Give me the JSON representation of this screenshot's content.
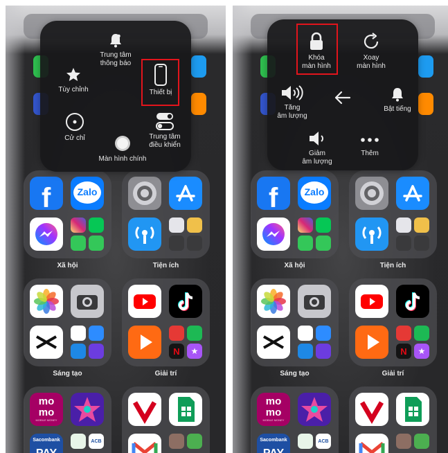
{
  "folders": {
    "social": "Xã hội",
    "utilities": "Tiện ích",
    "creative": "Sáng tạo",
    "entertainment": "Giải trí"
  },
  "apps": {
    "zalo": "Zalo",
    "momo_top": "mo",
    "momo_bottom": "mo",
    "momo_tag": "MOBILE MONEY",
    "sacombank": "Sacombank",
    "pay": "PAY",
    "acb": "ACB"
  },
  "left_menu": {
    "notification_center": "Trung tâm\nthông báo",
    "customize": "Tùy chỉnh",
    "device": "Thiết bị",
    "gestures": "Cử chỉ",
    "control_center": "Trung tâm\nđiều khiển",
    "home_screen": "Màn hình chính"
  },
  "right_menu": {
    "lock_screen": "Khóa\nmàn hình",
    "rotate_screen": "Xoay\nmàn hình",
    "volume_up": "Tăng\nâm lượng",
    "unmute": "Bật tiếng",
    "volume_down": "Giảm\nâm lượng",
    "more": "Thêm"
  },
  "colors": {
    "highlight": "#e3141c",
    "menu_bg": "#18181a",
    "folder_bg": "#4e4e52",
    "label": "#ececec"
  }
}
